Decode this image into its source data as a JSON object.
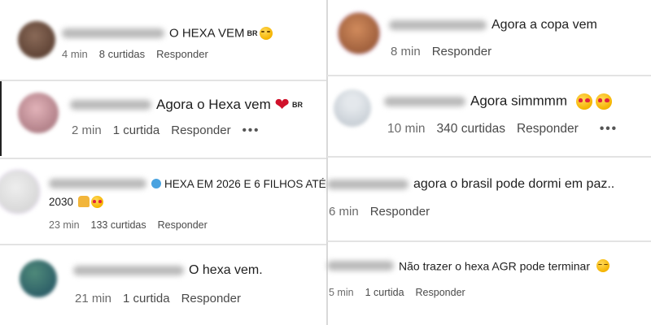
{
  "comments_left": [
    {
      "id": "c1",
      "text": "O HEXA VEM",
      "flag": "BR",
      "emojis": [
        "laugh"
      ],
      "time": "4 min",
      "likes": "8 curtidas",
      "reply": "Responder",
      "avatar_color": "#6b4a3a"
    },
    {
      "id": "c2",
      "text": "Agora o Hexa vem",
      "flag": "BR",
      "emojis": [
        "heart"
      ],
      "time": "2 min",
      "likes": "1 curtida",
      "reply": "Responder",
      "more": "•••",
      "avatar_color": "#b07a86"
    },
    {
      "id": "c3",
      "text": "HEXA EM 2026 E 6 FILHOS ATÉ",
      "text2": "2030",
      "emojis": [
        "pray",
        "stareyes"
      ],
      "time": "23 min",
      "likes": "133 curtidas",
      "reply": "Responder",
      "avatar_color": "#d8d8d8"
    },
    {
      "id": "c4",
      "text": "O hexa vem.",
      "time": "21 min",
      "likes": "1 curtida",
      "reply": "Responder",
      "avatar_color": "#2f6a73"
    }
  ],
  "comments_right": [
    {
      "id": "c5",
      "text": "Agora a copa vem",
      "time": "8 min",
      "reply": "Responder",
      "avatar_color": "#a46a4a"
    },
    {
      "id": "c6",
      "text": "Agora simmmm",
      "emojis": [
        "stareyes",
        "stareyes"
      ],
      "time": "10 min",
      "likes": "340 curtidas",
      "reply": "Responder",
      "more": "•••",
      "avatar_color": "#c9cfd6"
    },
    {
      "id": "c7",
      "text": "agora o brasil pode dormi em paz..",
      "time": "6 min",
      "reply": "Responder"
    },
    {
      "id": "c8",
      "text": "Não trazer o hexa AGR pode terminar",
      "emojis": [
        "laugh"
      ],
      "time": "5 min",
      "likes": "1 curtida",
      "reply": "Responder"
    }
  ]
}
